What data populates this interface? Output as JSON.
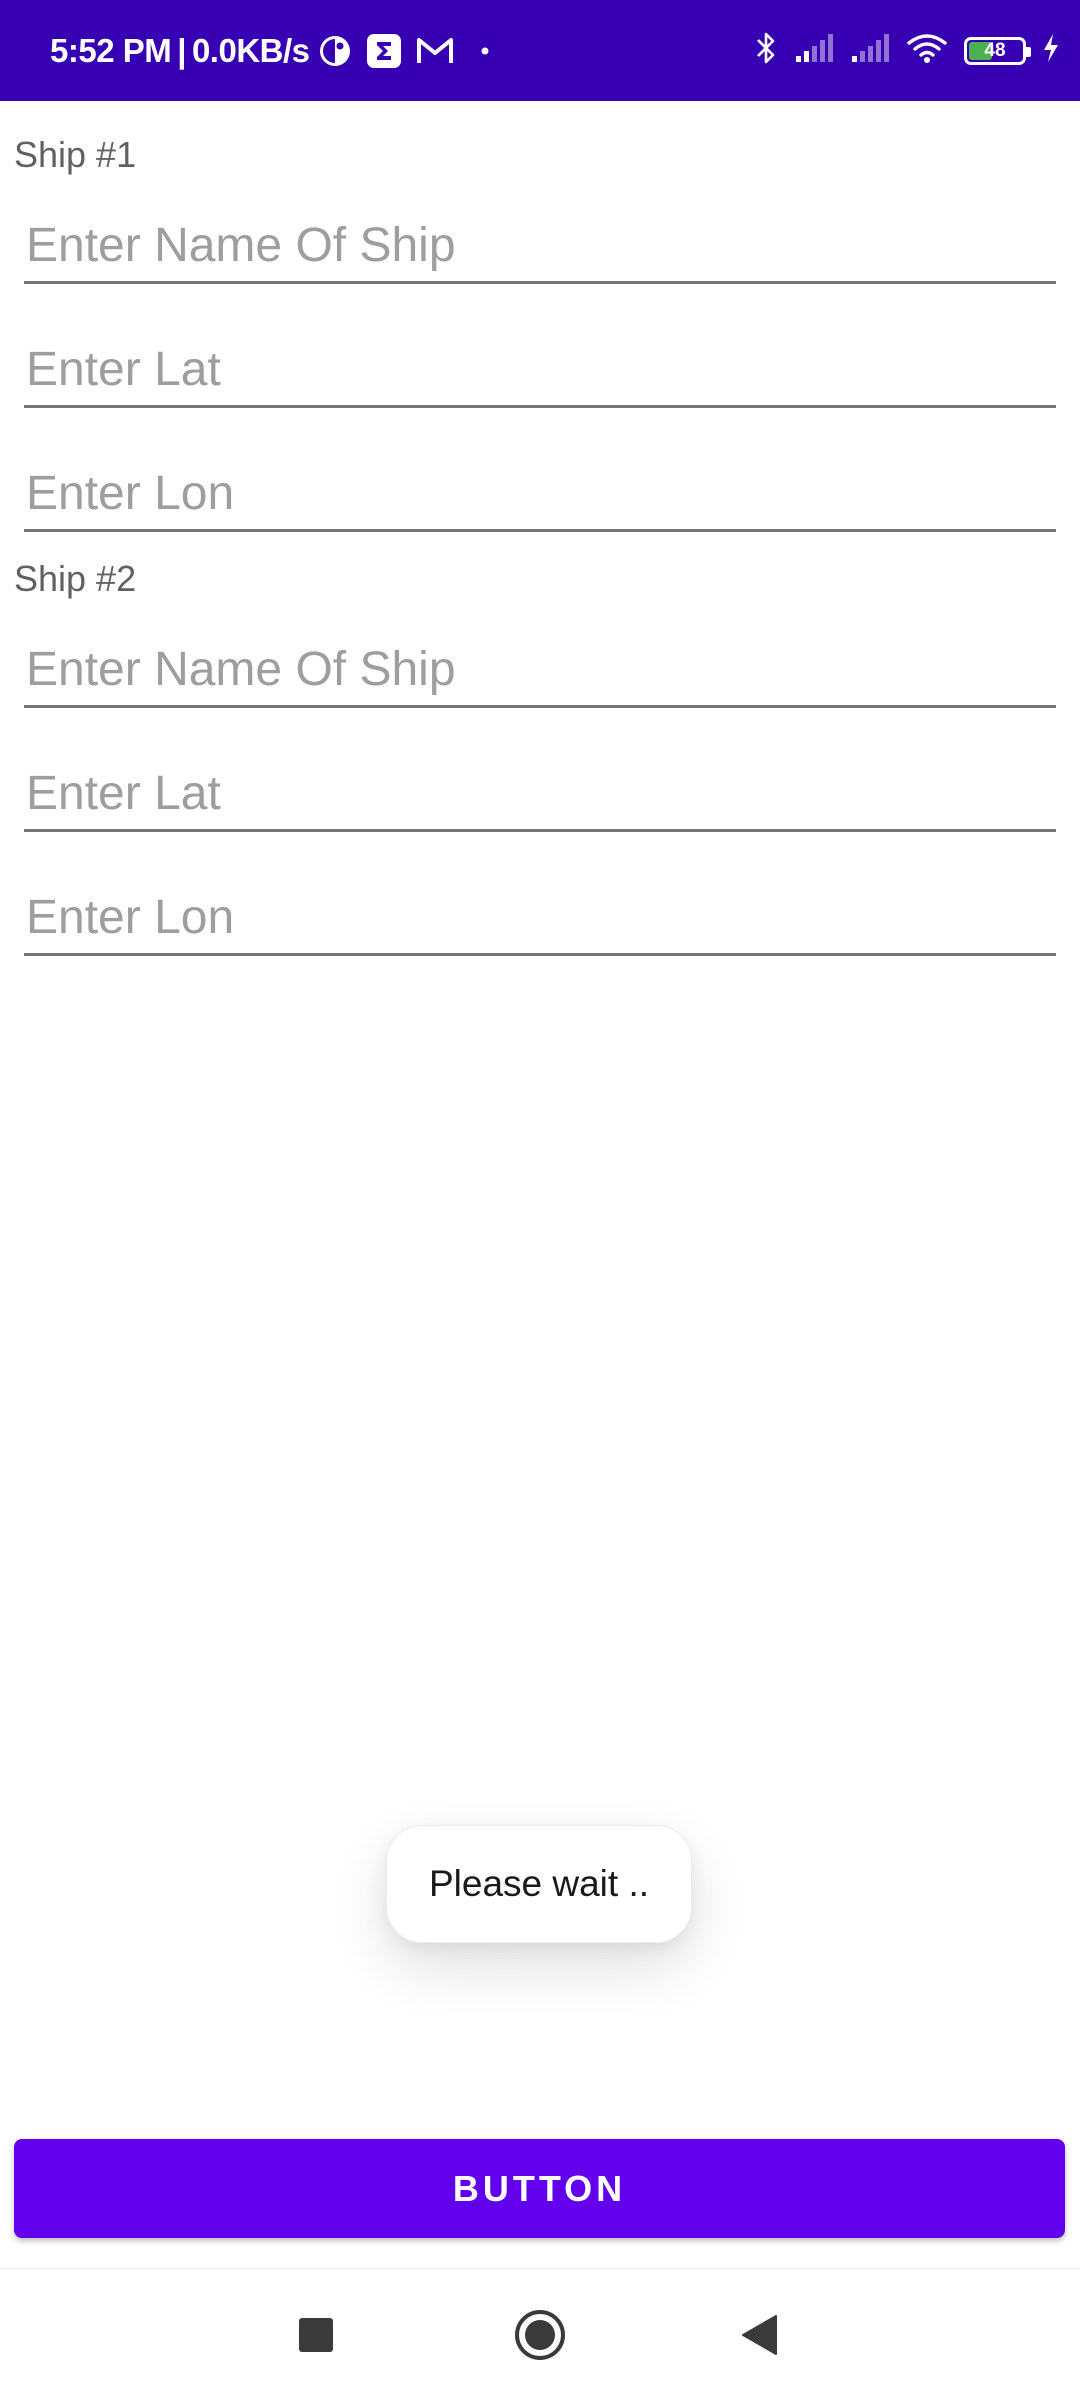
{
  "status_bar": {
    "time": "5:52 PM",
    "separator": "|",
    "network_speed": "0.0KB/s",
    "battery_level": "48",
    "battery_fraction": 0.48,
    "background_color": "#3700b3",
    "icons": [
      "notification-app-icon",
      "sigma-app-icon",
      "gmail-icon",
      "more-notifications-dot",
      "bluetooth-icon",
      "signal-icon",
      "signal-icon",
      "wifi-icon",
      "battery-icon",
      "charging-icon"
    ]
  },
  "form": {
    "ship1": {
      "label": "Ship #1",
      "name_placeholder": "Enter Name Of Ship",
      "name_value": "",
      "lat_placeholder": "Enter Lat",
      "lat_value": "",
      "lon_placeholder": "Enter Lon",
      "lon_value": ""
    },
    "ship2": {
      "label": "Ship #2",
      "name_placeholder": "Enter Name Of Ship",
      "name_value": "",
      "lat_placeholder": "Enter Lat",
      "lat_value": "",
      "lon_placeholder": "Enter Lon",
      "lon_value": ""
    }
  },
  "toast": {
    "message": "Please wait .."
  },
  "action": {
    "button_label": "BUTTON",
    "button_color": "#6200ee"
  },
  "nav_bar": {
    "icons": [
      "recents-square-icon",
      "home-circle-icon",
      "back-triangle-icon"
    ]
  }
}
